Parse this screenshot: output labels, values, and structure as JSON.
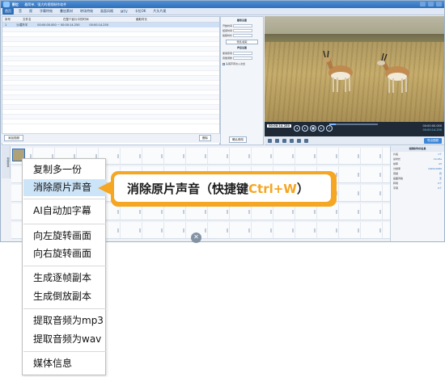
{
  "window": {
    "app_name": "影忆",
    "subtitle": "最简单、强大的视频制作软件"
  },
  "menubar": [
    "首页",
    "音",
    "视",
    "字幕特效",
    "叠加素材",
    "转场特效",
    "画面风格",
    "MTV",
    "卡拉OK",
    "片头片尾"
  ],
  "left_panel": {
    "columns": [
      "序号",
      "文件名",
      "在整个影片中的时间",
      "截取时长"
    ],
    "selected_row": {
      "index": "1",
      "name": "沙漠羚羊",
      "time": "00:00:00.000 ~ 00:00:14.250",
      "duration": "00:00:14.250"
    },
    "add_button": "添加视频",
    "delete_button": "删除"
  },
  "settings_panel": {
    "header": "截取设置",
    "fields": [
      "开始时间",
      "结束时间",
      "截取时长"
    ],
    "preview_button": "预览/截取",
    "audio_header": "声音设置",
    "audio_fields": [
      "使用原音",
      "音量调整"
    ],
    "checkbox_label": "头尾声音淡入淡出",
    "clear_button": "确认修改"
  },
  "player": {
    "current_time_box": "00:00:14.250",
    "elapsed": "00:00:00.000",
    "total": "00:00:14.250",
    "export_label": "导出视频"
  },
  "timeline": {
    "side_label": "视频轨道"
  },
  "properties_panel": {
    "header": "视频制作的信息",
    "items": [
      {
        "k": "片段",
        "v": "1个"
      },
      {
        "k": "总时长",
        "v": "14.25s"
      },
      {
        "k": "帧率",
        "v": "25"
      },
      {
        "k": "分辨率",
        "v": "1920x1080"
      },
      {
        "k": "音频",
        "v": "有"
      },
      {
        "k": "画面风格",
        "v": "无"
      },
      {
        "k": "转场",
        "v": "0个"
      },
      {
        "k": "字幕",
        "v": "0个"
      }
    ]
  },
  "context_menu": {
    "items": [
      "复制多一份",
      "消除原片声音",
      "AI自动加字幕",
      "向左旋转画面",
      "向右旋转画面",
      "生成逐帧副本",
      "生成倒放副本",
      "提取音频为mp3",
      "提取音频为wav",
      "媒体信息"
    ],
    "selected_index": 1
  },
  "callout": {
    "prefix": "消除原片声音（快捷键",
    "hotkey": "Ctrl+W",
    "suffix": "）"
  },
  "colors": {
    "accent_orange": "#f5a623",
    "menu_highlight": "#cce4f7",
    "brand_blue": "#2f6fb9"
  }
}
